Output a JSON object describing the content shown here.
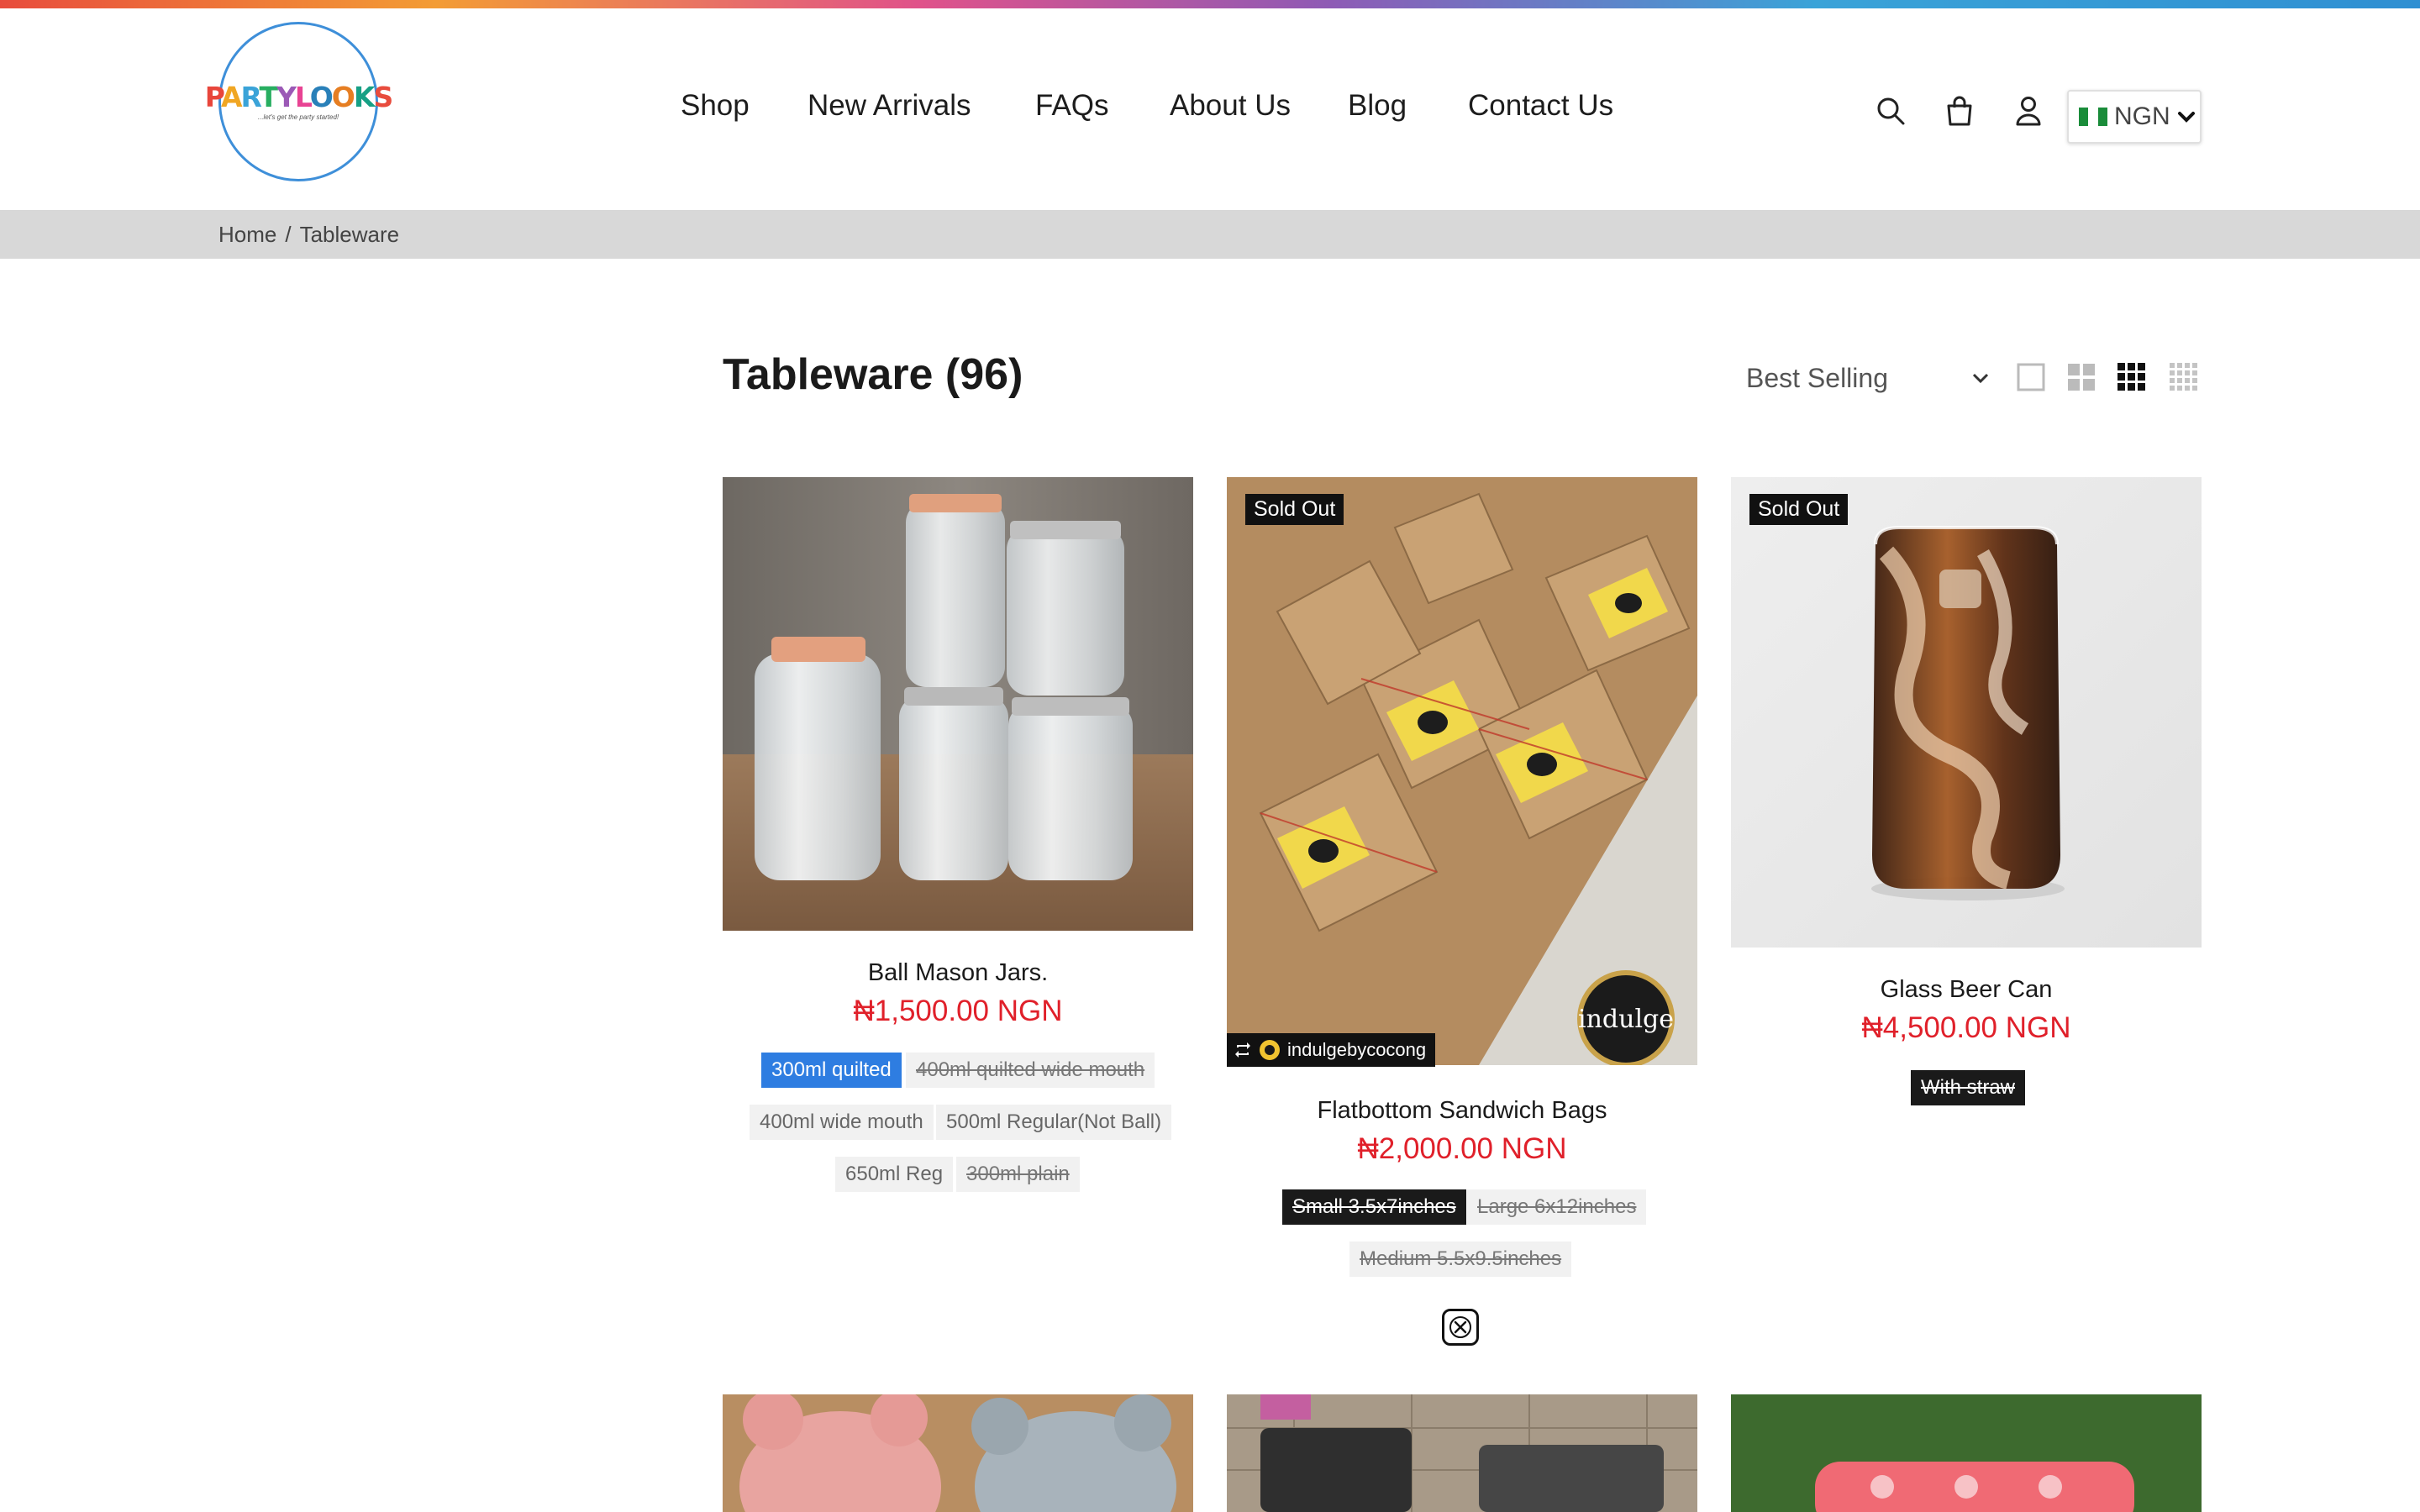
{
  "brand": {
    "logo_text": "PARTYLOOKS",
    "tagline": "...let's get the party started!"
  },
  "nav": {
    "items": [
      "Shop",
      "New Arrivals",
      "FAQs",
      "About Us",
      "Blog",
      "Contact Us"
    ]
  },
  "header_icons": [
    "search-icon",
    "cart-icon",
    "account-icon"
  ],
  "currency": {
    "code": "NGN"
  },
  "breadcrumb": {
    "home": "Home",
    "separator": "/",
    "current": "Tableware"
  },
  "collection": {
    "title": "Tableware (96)"
  },
  "sort": {
    "selected": "Best Selling"
  },
  "view_modes": [
    "1-column",
    "2-column",
    "3-column",
    "4-column"
  ],
  "products": [
    {
      "name": "Ball Mason Jars.",
      "price": "₦1,500.00 NGN",
      "variants": [
        {
          "label": "300ml quilted",
          "state": "selected"
        },
        {
          "label": "400ml quilted wide mouth",
          "state": "unavailable"
        },
        {
          "label": "400ml wide mouth",
          "state": "available"
        },
        {
          "label": "500ml Regular(Not Ball)",
          "state": "available"
        },
        {
          "label": "650ml Reg",
          "state": "available"
        },
        {
          "label": "300ml plain",
          "state": "unavailable"
        }
      ]
    },
    {
      "badge": "Sold Out",
      "name": "Flatbottom Sandwich Bags",
      "price": "₦2,000.00 NGN",
      "instagram_handle": "indulgebycocong",
      "image_brand": "indulge",
      "variants": [
        {
          "label": "Small 3.5x7inches",
          "state": "selected-unavailable"
        },
        {
          "label": "Large 6x12inches",
          "state": "unavailable"
        },
        {
          "label": "Medium 5.5x9.5inches",
          "state": "unavailable"
        }
      ]
    },
    {
      "badge": "Sold Out",
      "name": "Glass Beer Can",
      "price": "₦4,500.00 NGN",
      "variants": [
        {
          "label": "With straw",
          "state": "selected-unavailable"
        }
      ]
    }
  ],
  "colors": {
    "price": "#e0202a",
    "accent": "#2e7de1",
    "badge": "#111111"
  }
}
